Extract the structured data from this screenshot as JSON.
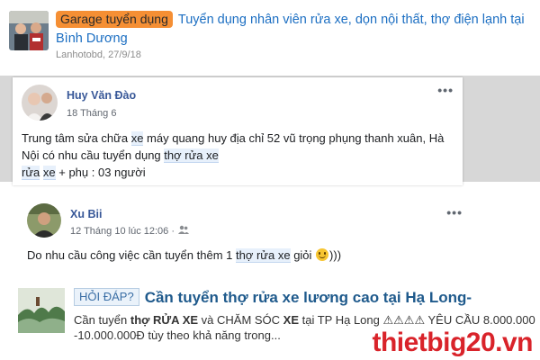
{
  "thread": {
    "prefix": "Garage tuyển dụng",
    "title": "Tuyển dụng nhân viên rửa xe, dọn nội thất, thợ điện lạnh tại Bình Dương",
    "author_date": "Lanhotobd, 27/9/18"
  },
  "post1": {
    "name": "Huy Văn Đào",
    "date": "18 Tháng 6",
    "more": "•••",
    "text_a": "Trung tâm sửa chữa ",
    "hl_1": "xe",
    "text_b": " máy quang huy địa chỉ 52 vũ trọng phụng thanh xuân, Hà Nội có nhu cầu tuyển dụng ",
    "hl_2": "thợ rửa xe",
    "text_c": " ",
    "hl_3": "rửa",
    "text_d": " ",
    "hl_4": "xe",
    "text_e": " + phụ : 03 người"
  },
  "post2": {
    "name": "Xu Bii",
    "date": "12 Tháng 10 lúc 12:06 ·",
    "more": "•••",
    "text_a": "Do nhu cầu công việc cần tuyển thêm 1 ",
    "hl_1": "thợ rửa xe",
    "text_b": " giỏi ",
    "text_c": ")))"
  },
  "result": {
    "badge": "HỎI ĐÁP?",
    "title": "Cần tuyển thợ rửa xe lương cao tại Hạ Long-",
    "snippet_a": "Cần tuyển ",
    "snippet_b1": "thợ",
    "snippet_b2": " RỬA XE",
    "snippet_c": " và CHĂM SÓC ",
    "snippet_d": "XE",
    "snippet_e": " tại TP Hạ Long ⚠⚠⚠⚠ YÊU CẦU 8.000.000 -10.000.000Đ tùy theo khả năng trong..."
  },
  "watermark": "thietbig20.vn"
}
